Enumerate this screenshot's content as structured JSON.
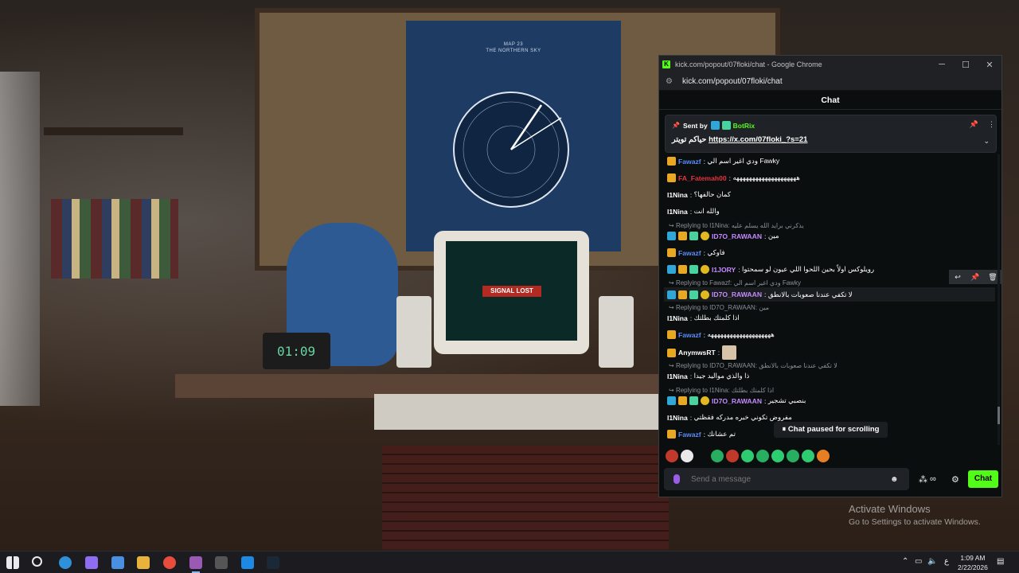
{
  "wallpaper": {
    "poster_line1": "MAP 23",
    "poster_line2": "THE NORTHERN SKY",
    "screen_text": "SIGNAL LOST",
    "clock_display": "01:09"
  },
  "watermark": {
    "line1": "Activate Windows",
    "line2": "Go to Settings to activate Windows."
  },
  "browser": {
    "window_title": "kick.com/popout/07floki/chat - Google Chrome",
    "url": "kick.com/popout/07floki/chat",
    "controls": {
      "minimize": "─",
      "maximize": "☐",
      "close": "✕"
    }
  },
  "chat": {
    "header": "Chat",
    "pinned": {
      "sent_by_label": "Sent by",
      "sender": "BotRix",
      "text_prefix": "حياكم تويتر",
      "link": "https://x.com/07floki_?s=21"
    },
    "messages": [
      {
        "user": "Fawazf",
        "color": "#5b8bf7",
        "text": "ودي اغير اسم الي Fawky"
      },
      {
        "user": "FA_Fatemah00",
        "color": "#e8323c",
        "text": "ههههههههههههههههههههه"
      },
      {
        "user": "I1Nina",
        "color": "#ffffff",
        "text": "كمان حالفها؟"
      },
      {
        "user": "I1Nina",
        "color": "#ffffff",
        "text": "والله انت"
      },
      {
        "reply": "Replying to I1Nina:",
        "reply_text": "يذكرني برايد الله يسلم عليه"
      },
      {
        "user": "ID7O_RAWAAN",
        "color": "#c58bff",
        "text": "مين"
      },
      {
        "user": "Fawazf",
        "color": "#5b8bf7",
        "text": "فاوكي"
      },
      {
        "user": "I1JORY",
        "color": "#c58bff",
        "text": "رويلوكس اولاً بحين اللحوا اللي عيون لو سمحتوا"
      },
      {
        "reply": "Replying to Fawazf:",
        "reply_text": "ودي اغير اسم الي Fawky"
      },
      {
        "user": "ID7O_RAWAAN",
        "color": "#c58bff",
        "text": "لا تكفي عندنا صعوبات بالانطق"
      },
      {
        "reply": "Replying to ID7O_RAWAAN:",
        "reply_text": "مين"
      },
      {
        "user": "I1Nina",
        "color": "#ffffff",
        "text": "اذا كلمتك بطلتك"
      },
      {
        "user": "Fawazf",
        "color": "#5b8bf7",
        "text": "ههههههههههههههههههههه"
      },
      {
        "user": "AnymwsRT",
        "color": "#ffffff",
        "text": ""
      },
      {
        "reply": "Replying to ID7O_RAWAAN:",
        "reply_text": "لا تكفي عندنا صعوبات بالانطق"
      },
      {
        "user": "I1Nina",
        "color": "#ffffff",
        "text": "ذا والذي مواليد جيدا"
      },
      {
        "reply": "Replying to I1Nina:",
        "reply_text": "اذا كلمتك بطلتك"
      },
      {
        "user": "ID7O_RAWAAN",
        "color": "#c58bff",
        "text": "بنصبي تشجير"
      },
      {
        "user": "I1Nina",
        "color": "#ffffff",
        "text": "مفروض تكوني خبره مدركه فقظتي"
      },
      {
        "user": "Fawazf",
        "color": "#5b8bf7",
        "text": "تم عشانك"
      }
    ],
    "paused_label": "Chat paused for scrolling",
    "input_placeholder": "Send a message",
    "send_label": "Chat",
    "accent": "#53fc18"
  },
  "taskbar": {
    "time": "1:09 AM",
    "date": "2/22/2026",
    "lang": "ع"
  }
}
